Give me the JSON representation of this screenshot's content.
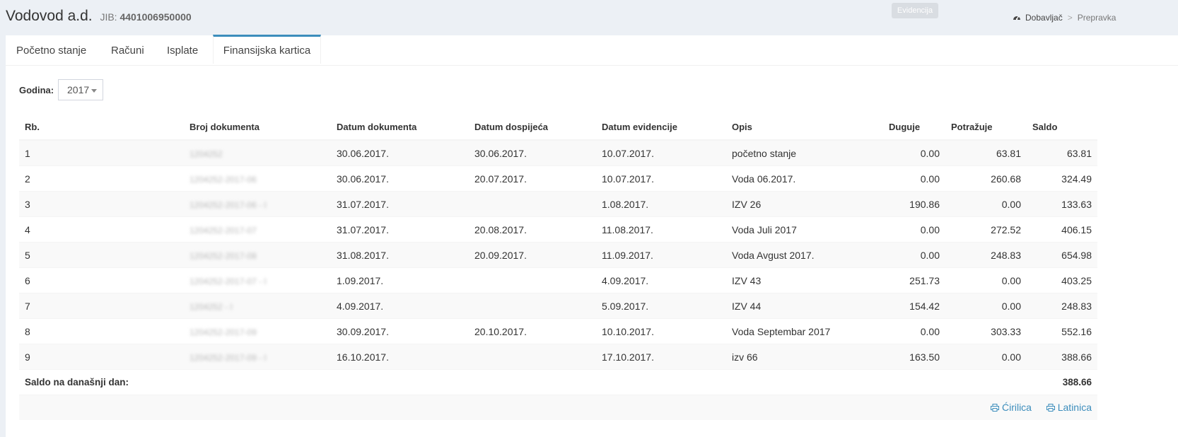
{
  "header": {
    "company_name": "Vodovod a.d.",
    "jib_label": "JIB:",
    "jib_value": "4401006950000",
    "tooltip": "Evidencija"
  },
  "breadcrumb": {
    "items": [
      "Dobavljač",
      "Prepravka"
    ],
    "separator": ">"
  },
  "tabs": [
    "Početno stanje",
    "Računi",
    "Isplate",
    "Finansijska kartica"
  ],
  "active_tab": "Finansijska kartica",
  "year_filter": {
    "label": "Godina:",
    "value": "2017"
  },
  "table": {
    "columns": [
      "Rb.",
      "Broj dokumenta",
      "Datum dokumenta",
      "Datum dospijeća",
      "Datum evidencije",
      "Opis",
      "Duguje",
      "Potražuje",
      "Saldo"
    ],
    "rows": [
      {
        "rb": "1",
        "broj": "1204252",
        "datum_dok": "30.06.2017.",
        "datum_dosp": "30.06.2017.",
        "datum_ev": "10.07.2017.",
        "opis": "početno stanje",
        "duguje": "0.00",
        "potrazuje": "63.81",
        "saldo": "63.81"
      },
      {
        "rb": "2",
        "broj": "1204252-2017-06",
        "datum_dok": "30.06.2017.",
        "datum_dosp": "20.07.2017.",
        "datum_ev": "10.07.2017.",
        "opis": "Voda 06.2017.",
        "duguje": "0.00",
        "potrazuje": "260.68",
        "saldo": "324.49"
      },
      {
        "rb": "3",
        "broj": "1204252-2017-06 - I",
        "datum_dok": "31.07.2017.",
        "datum_dosp": "",
        "datum_ev": "1.08.2017.",
        "opis": "IZV 26",
        "duguje": "190.86",
        "potrazuje": "0.00",
        "saldo": "133.63"
      },
      {
        "rb": "4",
        "broj": "1204252-2017-07",
        "datum_dok": "31.07.2017.",
        "datum_dosp": "20.08.2017.",
        "datum_ev": "11.08.2017.",
        "opis": "Voda Juli 2017",
        "duguje": "0.00",
        "potrazuje": "272.52",
        "saldo": "406.15"
      },
      {
        "rb": "5",
        "broj": "1204252-2017-08",
        "datum_dok": "31.08.2017.",
        "datum_dosp": "20.09.2017.",
        "datum_ev": "11.09.2017.",
        "opis": "Voda Avgust 2017.",
        "duguje": "0.00",
        "potrazuje": "248.83",
        "saldo": "654.98"
      },
      {
        "rb": "6",
        "broj": "1204252-2017-07 - I",
        "datum_dok": "1.09.2017.",
        "datum_dosp": "",
        "datum_ev": "4.09.2017.",
        "opis": "IZV 43",
        "duguje": "251.73",
        "potrazuje": "0.00",
        "saldo": "403.25"
      },
      {
        "rb": "7",
        "broj": "1204252 - I",
        "datum_dok": "4.09.2017.",
        "datum_dosp": "",
        "datum_ev": "5.09.2017.",
        "opis": "IZV 44",
        "duguje": "154.42",
        "potrazuje": "0.00",
        "saldo": "248.83"
      },
      {
        "rb": "8",
        "broj": "1204252-2017-09",
        "datum_dok": "30.09.2017.",
        "datum_dosp": "20.10.2017.",
        "datum_ev": "10.10.2017.",
        "opis": "Voda Septembar 2017",
        "duguje": "0.00",
        "potrazuje": "303.33",
        "saldo": "552.16"
      },
      {
        "rb": "9",
        "broj": "1204252-2017-09 - I",
        "datum_dok": "16.10.2017.",
        "datum_dosp": "",
        "datum_ev": "17.10.2017.",
        "opis": "izv 66",
        "duguje": "163.50",
        "potrazuje": "0.00",
        "saldo": "388.66"
      }
    ],
    "footer": {
      "label": "Saldo na današnji dan:",
      "total": "388.66"
    }
  },
  "print_links": {
    "cirilica": "Ćirilica",
    "latinica": "Latinica"
  },
  "colors": {
    "accent": "#3c8dbc",
    "background": "#ecf0f5"
  }
}
